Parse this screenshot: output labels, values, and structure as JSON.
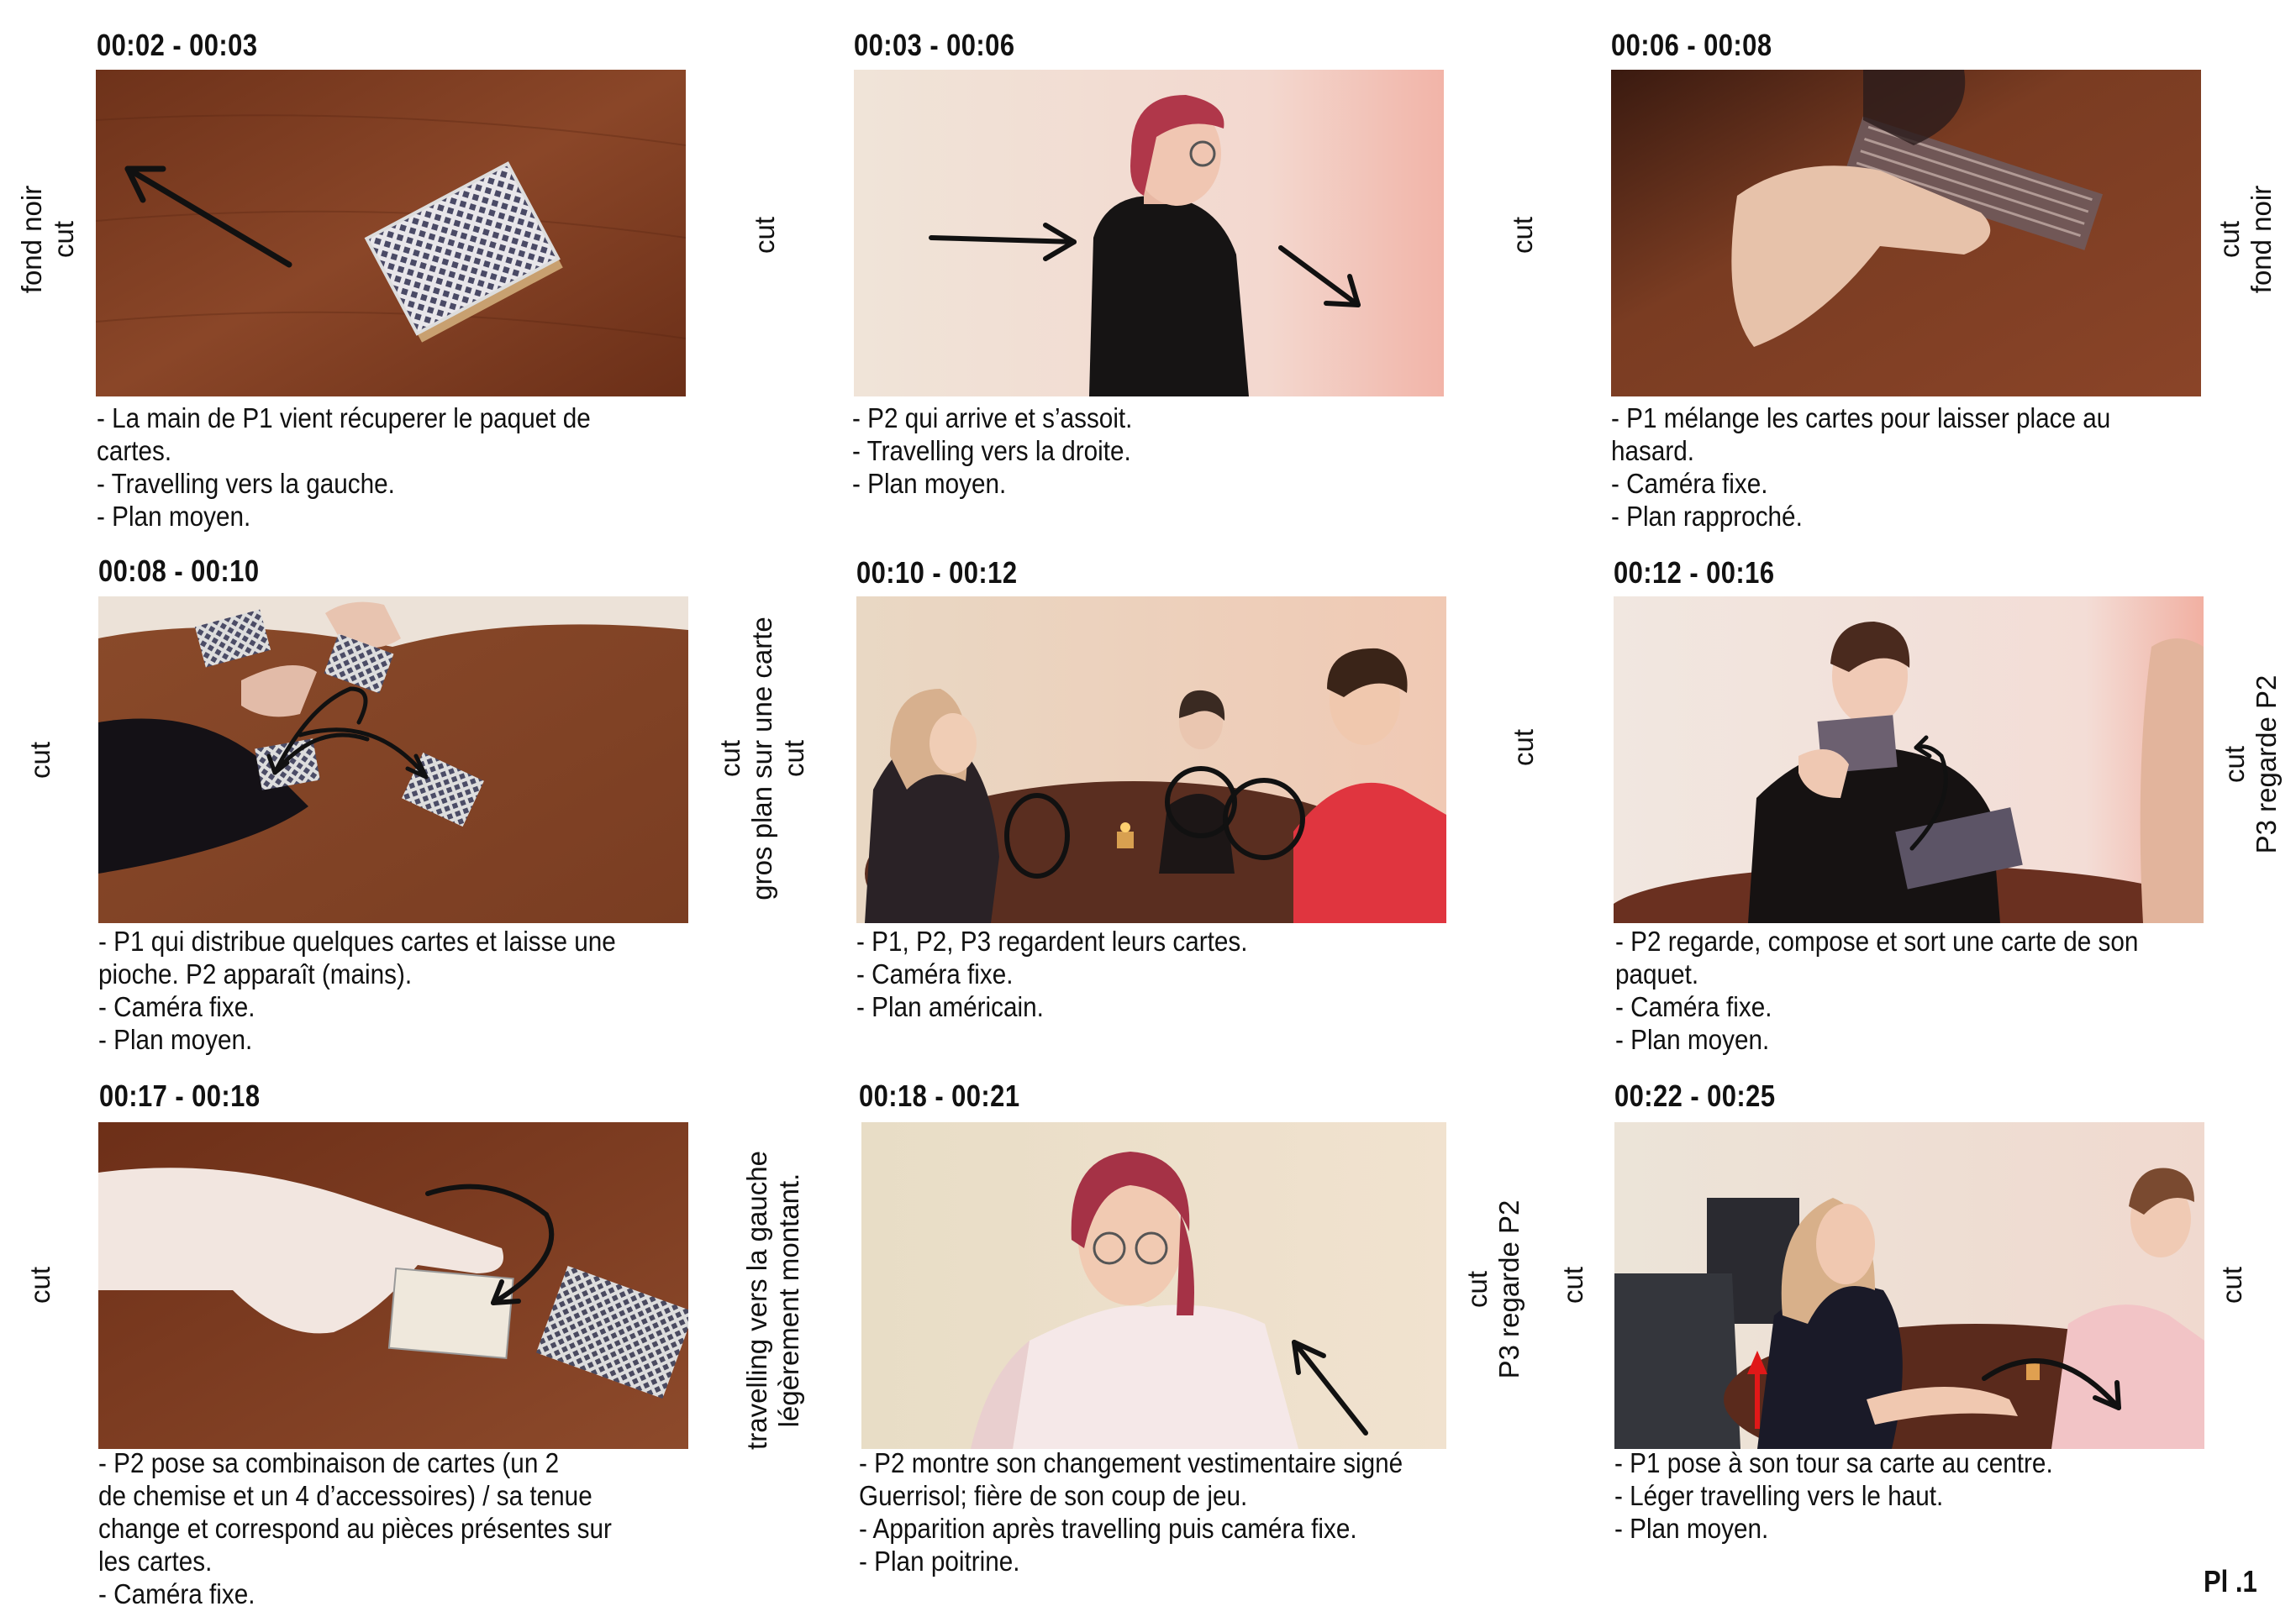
{
  "panels": [
    {
      "time": "00:02 - 00:03",
      "lines": [
        "- La main de P1 vient récuperer le paquet de",
        "cartes.",
        "- Travelling vers la gauche.",
        "- Plan moyen."
      ]
    },
    {
      "time": "00:03 - 00:06",
      "lines": [
        "- P2 qui arrive et s’assoit.",
        "- Travelling vers la droite.",
        "- Plan moyen."
      ]
    },
    {
      "time": "00:06 - 00:08",
      "lines": [
        "- P1 mélange les cartes pour laisser place au",
        "hasard.",
        "- Caméra fixe.",
        "- Plan rapproché."
      ]
    },
    {
      "time": "00:08 - 00:10",
      "lines": [
        "- P1 qui distribue quelques cartes et laisse une",
        "pioche. P2 apparaît (mains).",
        "- Caméra fixe.",
        "- Plan moyen."
      ]
    },
    {
      "time": "00:10 - 00:12",
      "lines": [
        "- P1, P2, P3 regardent leurs cartes.",
        "- Caméra fixe.",
        "- Plan américain."
      ]
    },
    {
      "time": "00:12 - 00:16",
      "lines": [
        "- P2 regarde, compose et sort une carte de son",
        "paquet.",
        "- Caméra fixe.",
        "- Plan moyen."
      ]
    },
    {
      "time": "00:17 - 00:18",
      "lines": [
        "- P2 pose sa combinaison de cartes (un 2",
        "de chemise et un 4 d’accessoires) / sa tenue",
        "change et correspond au pièces présentes sur",
        "les cartes.",
        "- Caméra fixe."
      ]
    },
    {
      "time": "00:18 - 00:21",
      "lines": [
        "- P2 montre son changement vestimentaire signé",
        "Guerrisol; fière de son coup de jeu.",
        "- Apparition après travelling puis caméra fixe.",
        "- Plan poitrine."
      ]
    },
    {
      "time": "00:22 - 00:25",
      "lines": [
        "- P1 pose à son tour sa carte au centre.",
        "- Léger travelling vers le haut.",
        "- Plan moyen."
      ]
    }
  ],
  "transitions": [
    {
      "lines": [
        "fond noir",
        "cut"
      ]
    },
    {
      "lines": [
        "cut"
      ]
    },
    {
      "lines": [
        "cut"
      ]
    },
    {
      "lines": [
        "cut",
        "fond noir"
      ]
    },
    {
      "lines": [
        "cut"
      ]
    },
    {
      "lines": [
        "cut",
        "gros plan sur une carte",
        "cut"
      ]
    },
    {
      "lines": [
        "cut"
      ]
    },
    {
      "lines": [
        "cut",
        "P3 regarde P2"
      ]
    },
    {
      "lines": [
        "cut"
      ]
    },
    {
      "lines": [
        "travelling vers la gauche",
        "légèrement montant."
      ]
    },
    {
      "lines": [
        "cut",
        "P3 regarde P2"
      ]
    },
    {
      "lines": [
        "cut"
      ]
    },
    {
      "lines": [
        "cut"
      ]
    }
  ],
  "page_number": "Pl .1",
  "colors": {
    "table_wood": "#7a3d22",
    "wall_warm": "#efe0d2",
    "arrow": "#111111",
    "arrow_red": "#e01818"
  }
}
